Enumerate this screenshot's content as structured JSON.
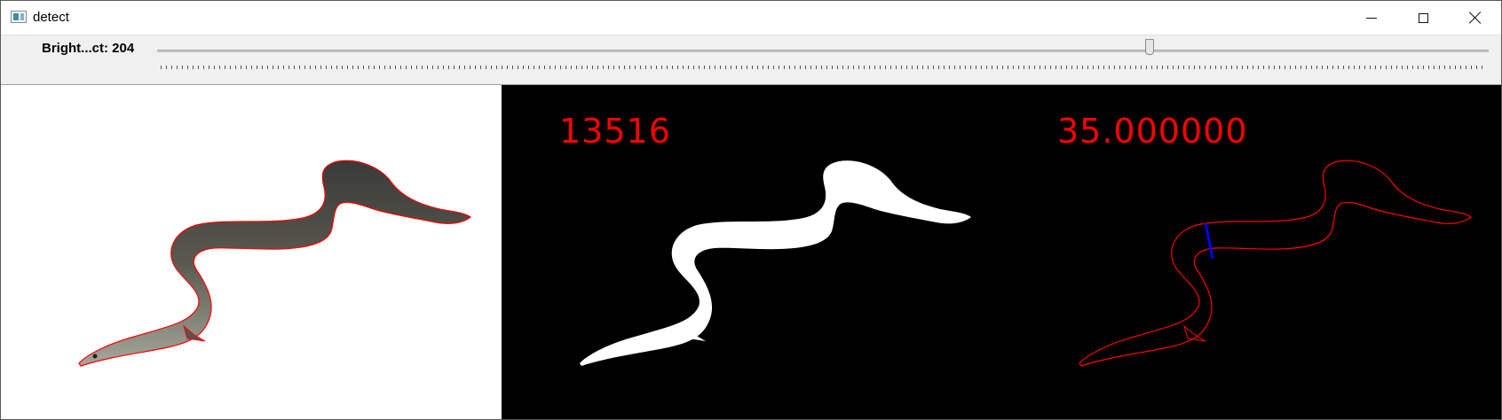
{
  "window": {
    "title": "detect",
    "icons": {
      "app": "app-window-icon",
      "minimize": "minimize-icon",
      "maximize": "maximize-icon",
      "close": "close-icon"
    }
  },
  "trackbar": {
    "label": "Bright...ct: 204",
    "value_fraction": 0.745
  },
  "panels": {
    "mask_value": "13516",
    "contour_value": "35.000000"
  },
  "colors": {
    "overlay_text": "#ff0000",
    "contour": "#ff0000",
    "width_line": "#0000ff",
    "mask": "#ffffff",
    "background": "#000000"
  }
}
